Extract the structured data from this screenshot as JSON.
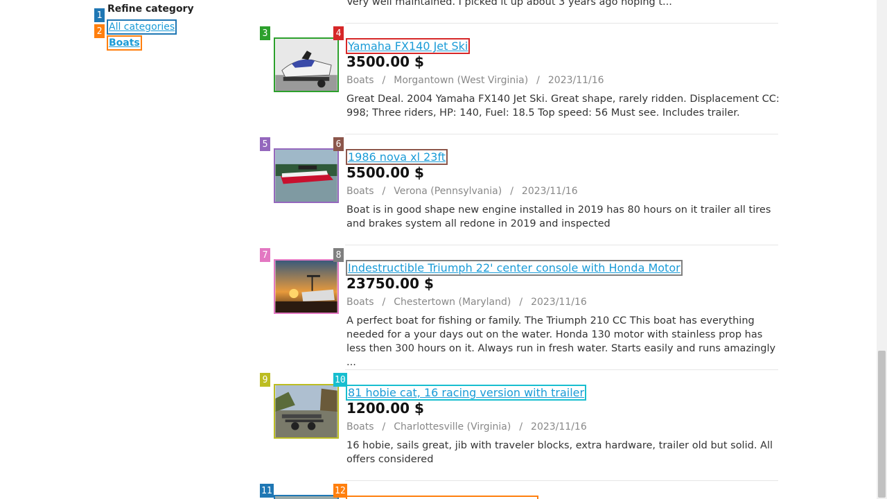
{
  "sidebar": {
    "title": "Refine category",
    "categories": [
      {
        "label": "All categories",
        "badge": "1"
      },
      {
        "label": "Boats",
        "badge": "2"
      }
    ],
    "title_badge": "1"
  },
  "top_fragment": "Very well maintained. I picked it up about 3 years ago hoping t...",
  "listings": [
    {
      "img_badge": "3",
      "title_badge": "4",
      "title": "Yamaha FX140 Jet Ski",
      "price": "3500.00 $",
      "category": "Boats",
      "location": "Morgantown (West Virginia)",
      "date": "2023/11/16",
      "desc": "Great Deal. 2004 Yamaha FX140 Jet Ski. Great shape, rarely ridden. Displacement CC: 998; Three riders, HP: 140, Fuel: 18.5 Top speed: 56 Must see. Includes trailer.",
      "img_color": "#2ca02c",
      "title_color": "#d62728"
    },
    {
      "img_badge": "5",
      "title_badge": "6",
      "title": "1986 nova xl 23ft",
      "price": "5500.00 $",
      "category": "Boats",
      "location": "Verona (Pennsylvania)",
      "date": "2023/11/16",
      "desc": "Boat is in good shape new engine installed in 2019 has 80 hours on it trailer all tires and brakes system all redone in 2019 and inspected",
      "img_color": "#9467bd",
      "title_color": "#8c564b"
    },
    {
      "img_badge": "7",
      "title_badge": "8",
      "title": "Indestructible Triumph 22' center console with Honda Motor",
      "price": "23750.00 $",
      "category": "Boats",
      "location": "Chestertown (Maryland)",
      "date": "2023/11/16",
      "desc": "A perfect boat for fishing or family. The Triumph 210 CC This boat has everything needed for a your days out on the water. Honda 130 motor with stainless prop has less then 300 hours on it. Always run in fresh water. Starts easily and runs amazingly ...",
      "img_color": "#e377c2",
      "title_color": "#7f7f7f"
    },
    {
      "img_badge": "9",
      "title_badge": "10",
      "title": "81 hobie cat, 16 racing version with trailer",
      "price": "1200.00 $",
      "category": "Boats",
      "location": "Charlottesville (Virginia)",
      "date": "2023/11/16",
      "desc": "16 hobie, sails great, jib with traveler blocks, extra hardware, trailer old but solid. All offers considered",
      "img_color": "#bcbd22",
      "title_color": "#17becf"
    }
  ],
  "next_badges": {
    "img": "11",
    "title": "12"
  },
  "colors": {
    "link": "#1a9bd7",
    "badge_1": "#1f77b4",
    "badge_2": "#ff7f0e",
    "badge_11": "#1f77b4",
    "badge_12": "#ff7f0e"
  }
}
